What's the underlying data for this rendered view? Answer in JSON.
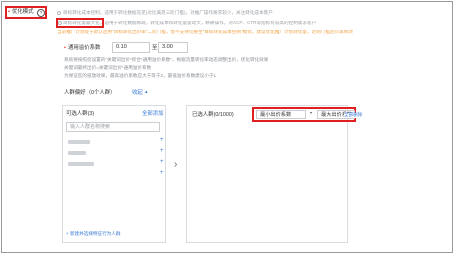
{
  "optimize_mode": {
    "label": "优化模式",
    "help_icon": "question-circle-icon"
  },
  "radios": [
    {
      "text": "目标转化成本控制，适用于转化数据充足(对比满足三阶门槛)，对推广操作要求较少，关注转化成本客户"
    },
    {
      "text": "目标转化量最大化，适用于转化数据稀疏，转化成本和转化量波动大，精耕操作，对ACP、CTR等指标有较高的控制需求客户"
    }
  ],
  "notice": "当前推广计划处于默认启用\"目标转化出价率\"二阶门槛，暂不支持切换至\"目标转化成本控制\"模式，建议优化推广计划转化量，达到门槛后可再修改",
  "general_bid": {
    "label": "通用溢价系数",
    "min": "0.10",
    "to": "至",
    "max": "3.00"
  },
  "bid_notes": [
    "系统将按照您设置的\"关键词出价*综合*通用溢价系数\"，根据流量转化率动态调整出价，优化转化效果",
    "关键词最终出价=关键词出价*通用溢价系数",
    "为保证您的投放效果，最高溢价系数应大于等于2，最低溢价系数建议小于1"
  ],
  "crowd": {
    "label": "人群偏好（0个人群）",
    "collapse_link": "收起",
    "collapse_arrow": "chevron-up-icon"
  },
  "left_panel": {
    "title": "可选人群(3)",
    "add_all": "全部添加",
    "search_placeholder": "输入人群名称搜索",
    "item_plus": [
      "+",
      "+",
      "+",
      "+"
    ],
    "new_crowd": "+ 新建并选择特征行为人群"
  },
  "arrow": "›",
  "right_panel": {
    "title": "已选人群(0/1000)",
    "min_select": "最小出价系数",
    "max_select": "最大出价系数",
    "delete_all": "全部删除"
  }
}
